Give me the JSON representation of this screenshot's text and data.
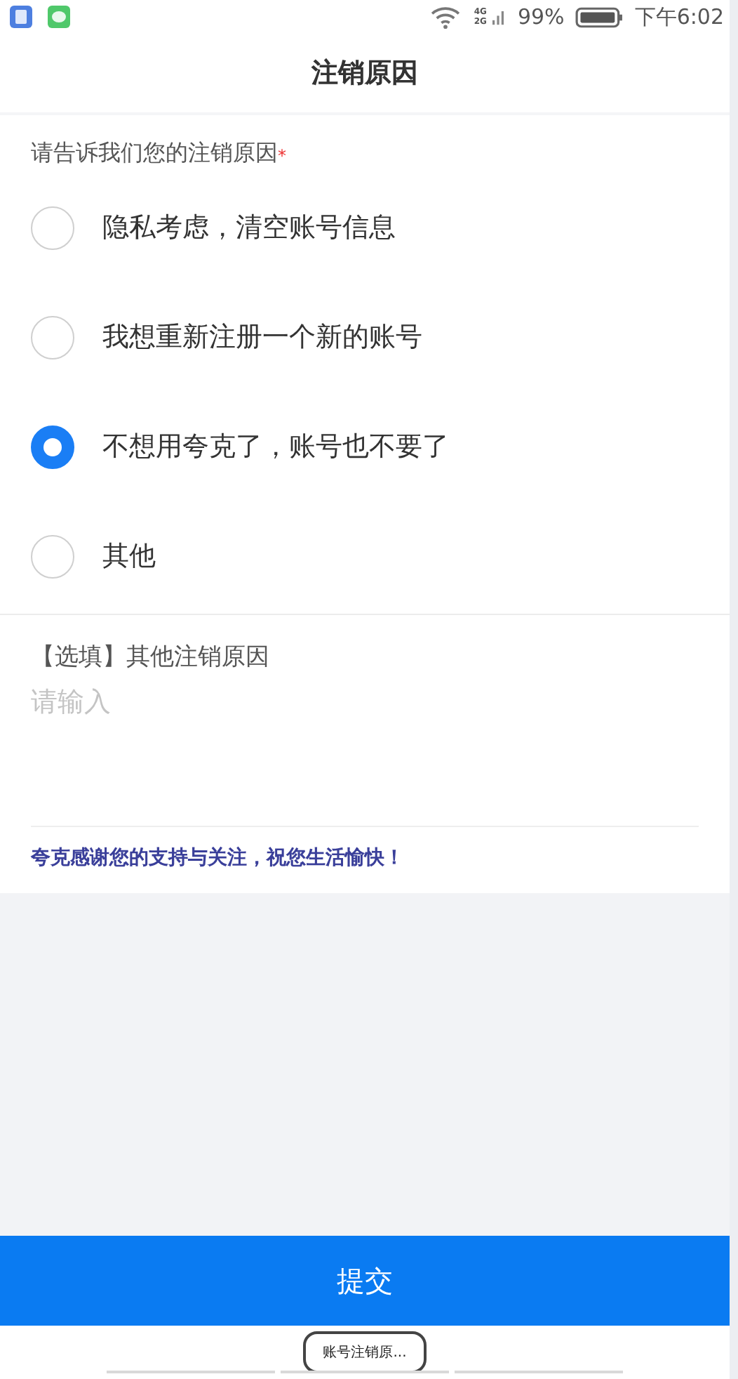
{
  "status_bar": {
    "battery": "99%",
    "time": "下午6:02",
    "network_top": "4G",
    "network_bottom": "2G"
  },
  "header": {
    "title": "注销原因"
  },
  "question": {
    "label": "请告诉我们您的注销原因",
    "required_mark": "*"
  },
  "options": [
    {
      "label": "隐私考虑，清空账号信息",
      "selected": false
    },
    {
      "label": "我想重新注册一个新的账号",
      "selected": false
    },
    {
      "label": "不想用夸克了，账号也不要了",
      "selected": true
    },
    {
      "label": "其他",
      "selected": false
    }
  ],
  "other_reason": {
    "label": "【选填】其他注销原因",
    "placeholder": "请输入"
  },
  "thanks": "夸克感谢您的支持与关注，祝您生活愉快！",
  "submit_button": "提交",
  "task_label": "账号注销原..."
}
